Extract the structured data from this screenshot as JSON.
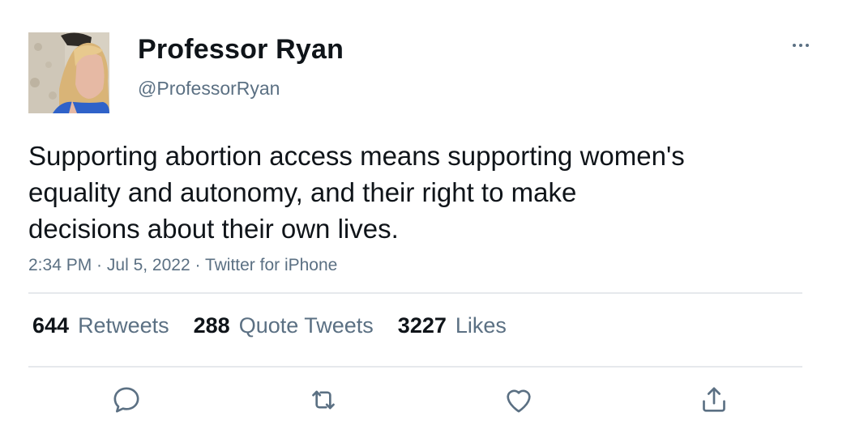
{
  "author": {
    "display_name": "Professor Ryan",
    "handle": "@ProfessorRyan",
    "avatar": "profile-photo-woman-blonde-blue-top"
  },
  "tweet": {
    "text": "Supporting abortion access means supporting women's\nequality and autonomy, and their right to make\ndecisions about their own lives.",
    "time": "2:34 PM",
    "date": "Jul 5, 2022",
    "source": "Twitter for iPhone",
    "separator": " · "
  },
  "stats": {
    "retweets_count": "644",
    "retweets_label": "Retweets",
    "quote_count": "288",
    "quote_label": "Quote Tweets",
    "likes_count": "3227",
    "likes_label": "Likes"
  },
  "actions": {
    "reply": "reply-icon",
    "retweet": "retweet-icon",
    "like": "heart-icon",
    "share": "share-icon",
    "more": "more-options-icon"
  },
  "colors": {
    "text": "#0f1419",
    "secondary": "#5b7083",
    "divider": "#e6e9ec",
    "background": "#ffffff"
  }
}
